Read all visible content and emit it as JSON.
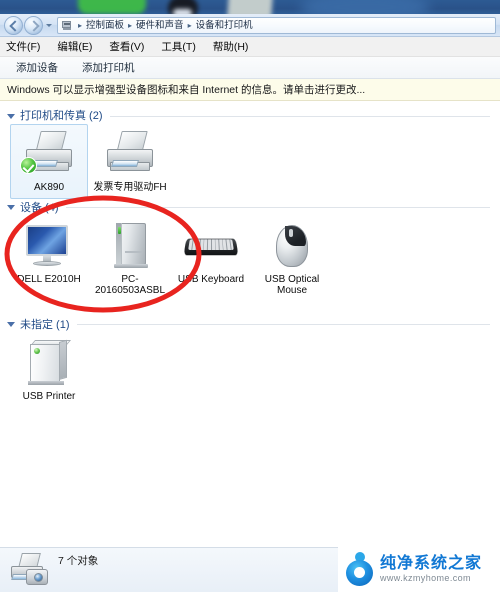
{
  "desktop": {
    "name": "desktop-background"
  },
  "window": {
    "nav": {
      "back_label": "后退",
      "forward_label": "前进",
      "history_label": "最近浏览的位置",
      "breadcrumbs": [
        "控制面板",
        "硬件和声音",
        "设备和打印机"
      ],
      "separator": "▸",
      "control_panel_icon": "control-panel-icon"
    },
    "menu": [
      "文件(F)",
      "编辑(E)",
      "查看(V)",
      "工具(T)",
      "帮助(H)"
    ],
    "toolbar": [
      "添加设备",
      "添加打印机"
    ],
    "infobar": {
      "text": "Windows 可以显示增强型设备图标和来自 Internet 的信息。请单击进行更改..."
    },
    "groups": [
      {
        "title": "打印机和传真 (2)",
        "items": [
          {
            "label": "AK890",
            "icon": "printer-icon",
            "selected": true,
            "default_printer": true
          },
          {
            "label": "发票专用驱动FH",
            "icon": "printer-icon",
            "selected": false,
            "default_printer": false
          }
        ]
      },
      {
        "title": "设备 (4)",
        "items": [
          {
            "label": "DELL E2010H",
            "icon": "monitor-icon",
            "selected": false
          },
          {
            "label": "PC-20160503ASBL",
            "icon": "computer-tower-icon",
            "selected": false
          },
          {
            "label": "USB Keyboard",
            "icon": "keyboard-icon",
            "selected": false
          },
          {
            "label": "USB Optical Mouse",
            "icon": "mouse-icon",
            "selected": false
          }
        ]
      },
      {
        "title": "未指定 (1)",
        "items": [
          {
            "label": "USB Printer",
            "icon": "usb-printer-icon",
            "selected": false
          }
        ]
      }
    ],
    "annotation": {
      "shape": "ellipse",
      "color": "#e8241f",
      "stroke_width": 5
    },
    "statusbar": {
      "count_text": "7 个对象",
      "icon": "printer-camera-icon"
    }
  },
  "watermark": {
    "title": "纯净系统之家",
    "url": "www.kzmyhome.com",
    "logo": "circle-logo-icon",
    "brand_color": "#1178d4"
  }
}
